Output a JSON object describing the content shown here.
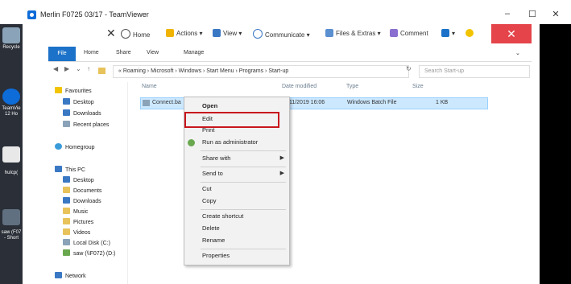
{
  "window": {
    "title": "Merlin F0725 03/17 - TeamViewer",
    "minimize": "–",
    "maximize": "☐",
    "close": "✕"
  },
  "ribbon": {
    "home": "Home",
    "actions": "Actions",
    "view": "View",
    "communicate": "Communicate",
    "files_extras": "Files & Extras",
    "comment": "Comment",
    "close": "✕"
  },
  "desktop": {
    "recycle": "Recycle",
    "teamviewer": "TeamVie 12 Ho",
    "hulcp": "hulcp(",
    "saw": "saw (F07 - Short"
  },
  "explorer": {
    "tabs": {
      "file": "File",
      "home": "Home",
      "share": "Share",
      "view": "View",
      "manage": "Manage"
    },
    "address": "« Roaming › Microsoft › Windows › Start Menu › Programs › Start-up",
    "search_placeholder": "Search Start-up",
    "nav": {
      "favourites": "Favourites",
      "desktop": "Desktop",
      "downloads": "Downloads",
      "recent": "Recent places",
      "homegroup": "Homegroup",
      "thispc": "This PC",
      "pc_desktop": "Desktop",
      "documents": "Documents",
      "pc_downloads": "Downloads",
      "music": "Music",
      "pictures": "Pictures",
      "videos": "Videos",
      "local_disk": "Local Disk (C:)",
      "saw": "saw (\\\\F072) (D:)",
      "network": "Network"
    },
    "columns": {
      "name": "Name",
      "date": "Date modified",
      "type": "Type",
      "size": "Size"
    },
    "file": {
      "name": "Connect.ba",
      "date": "/11/2019 16:06",
      "type": "Windows Batch File",
      "size": "1 KB"
    }
  },
  "context_menu": {
    "open": "Open",
    "edit": "Edit",
    "print": "Print",
    "run_admin": "Run as administrator",
    "share_with": "Share with",
    "send_to": "Send to",
    "cut": "Cut",
    "copy": "Copy",
    "create_shortcut": "Create shortcut",
    "delete": "Delete",
    "rename": "Rename",
    "properties": "Properties"
  },
  "colors": {
    "teamviewer_blue": "#0e6cd8",
    "file_tab": "#1c72c8",
    "close_red": "#e4444a",
    "highlight": "#c8161d"
  }
}
